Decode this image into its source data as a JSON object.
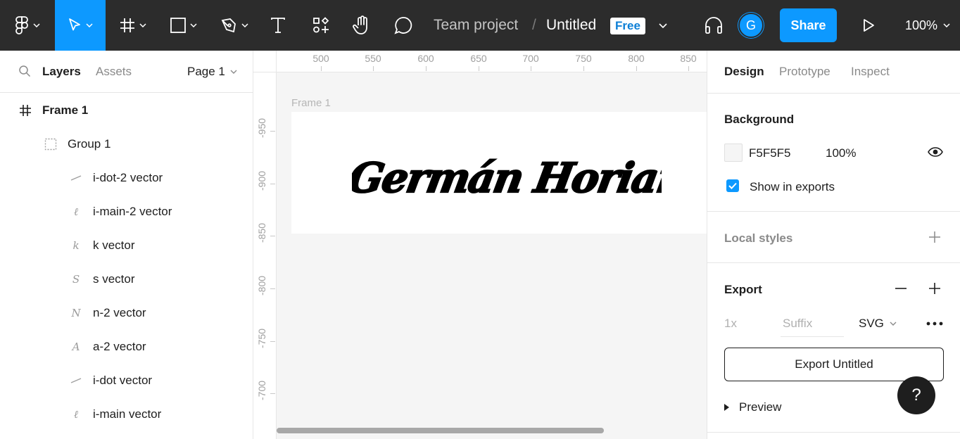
{
  "toolbar": {
    "breadcrumb_team": "Team project",
    "breadcrumb_sep": "/",
    "file_name": "Untitled",
    "plan_badge": "Free",
    "avatar_initial": "G",
    "share_label": "Share",
    "zoom": "100%"
  },
  "left_panel": {
    "tabs": {
      "layers": "Layers",
      "assets": "Assets"
    },
    "page_selector": "Page 1",
    "layers": [
      {
        "label": "Frame 1",
        "icon": "frame-icon"
      },
      {
        "label": "Group 1",
        "icon": "group-icon"
      },
      {
        "label": "i-dot-2 vector",
        "icon": "vector-icon"
      },
      {
        "label": "i-main-2 vector",
        "icon": "vector-icon"
      },
      {
        "label": "k vector",
        "icon": "vector-icon"
      },
      {
        "label": "s vector",
        "icon": "vector-icon"
      },
      {
        "label": "n-2 vector",
        "icon": "vector-icon"
      },
      {
        "label": "a-2 vector",
        "icon": "vector-icon"
      },
      {
        "label": "i-dot vector",
        "icon": "vector-icon"
      },
      {
        "label": "i-main vector",
        "icon": "vector-icon"
      }
    ]
  },
  "canvas": {
    "ruler_top": [
      "500",
      "550",
      "600",
      "650",
      "700",
      "750",
      "800",
      "850"
    ],
    "ruler_left": [
      "-950",
      "-900",
      "-850",
      "-800",
      "-750",
      "-700"
    ],
    "frame_label": "Frame 1",
    "signature_text": "Germán Horianski"
  },
  "right_panel": {
    "tabs": {
      "design": "Design",
      "prototype": "Prototype",
      "inspect": "Inspect"
    },
    "background": {
      "title": "Background",
      "hex": "F5F5F5",
      "opacity": "100%",
      "color": "#f5f5f5",
      "show_in_exports": "Show in exports"
    },
    "local_styles": {
      "title": "Local styles"
    },
    "export": {
      "title": "Export",
      "scale": "1x",
      "suffix_placeholder": "Suffix",
      "format": "SVG",
      "button_label": "Export Untitled",
      "preview_label": "Preview"
    },
    "help": "?"
  },
  "colors": {
    "accent": "#0d99ff",
    "toolbar_bg": "#2c2c2c",
    "canvas_bg": "#f5f5f5"
  }
}
